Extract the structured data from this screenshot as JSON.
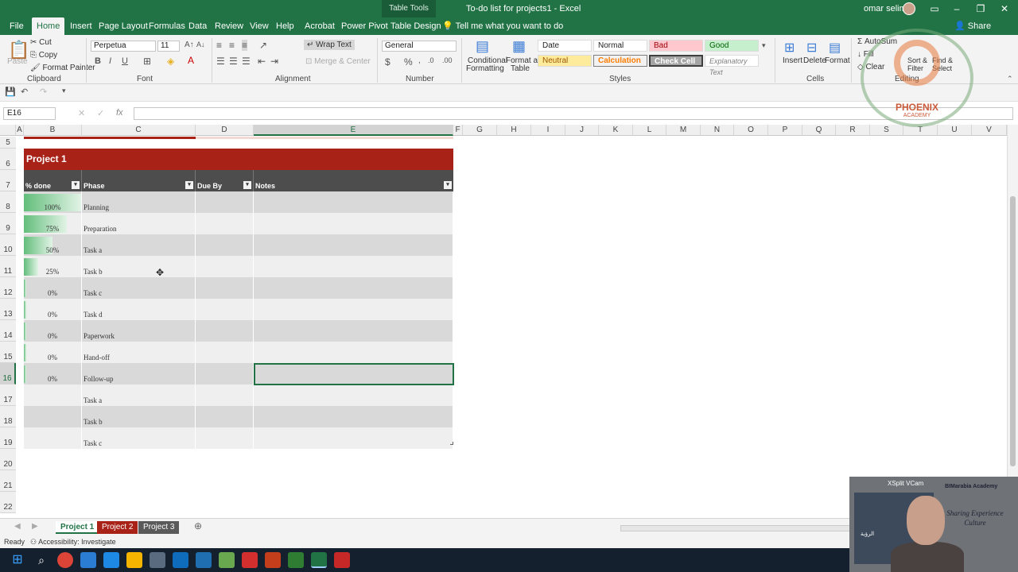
{
  "window": {
    "table_tools": "Table Tools",
    "title": "To-do list for projects1 - Excel",
    "user": "omar selim"
  },
  "ribbon_tabs": [
    "File",
    "Home",
    "Insert",
    "Page Layout",
    "Formulas",
    "Data",
    "Review",
    "View",
    "Help",
    "Acrobat",
    "Power Pivot",
    "Table Design"
  ],
  "tell_me": "Tell me what you want to do",
  "share": "Share",
  "clipboard": {
    "cut": "Cut",
    "copy": "Copy",
    "format_painter": "Format Painter",
    "paste": "Paste",
    "label": "Clipboard"
  },
  "font": {
    "name": "Perpetua",
    "size": "11",
    "label": "Font"
  },
  "alignment": {
    "wrap": "Wrap Text",
    "merge": "Merge & Center",
    "label": "Alignment"
  },
  "number": {
    "format": "General",
    "label": "Number"
  },
  "styles": {
    "conditional": "Conditional",
    "formatting": "Formatting",
    "format_as": "Format as",
    "table": "Table",
    "cells": [
      "Date",
      "Normal",
      "Bad",
      "Good",
      "Neutral",
      "Calculation",
      "Check Cell",
      "Explanatory Text"
    ],
    "label": "Styles"
  },
  "cells_group": {
    "insert": "Insert",
    "delete": "Delete",
    "format": "Format",
    "label": "Cells"
  },
  "editing": {
    "autosum": "AutoSum",
    "fill": "Fill",
    "clear": "Clear",
    "sort": "Sort &",
    "filter": "Filter",
    "find": "Find &",
    "select": "Select",
    "label": "Editing"
  },
  "formula_bar": {
    "name_box": "E16",
    "fx": "fx"
  },
  "columns": [
    "A",
    "B",
    "C",
    "D",
    "E",
    "F",
    "G",
    "H",
    "I",
    "J",
    "K",
    "L",
    "M",
    "N",
    "O",
    "P",
    "Q",
    "R",
    "S",
    "T",
    "U",
    "V"
  ],
  "rows": [
    "5",
    "6",
    "7",
    "8",
    "9",
    "10",
    "11",
    "12",
    "13",
    "14",
    "15",
    "16",
    "17",
    "18",
    "19",
    "20",
    "21",
    "22"
  ],
  "table": {
    "title": "Project 1",
    "headers": [
      "% done",
      "Phase",
      "Due By",
      "Notes"
    ],
    "rows": [
      {
        "pct": "100%",
        "fill": 1.0,
        "phase": "Planning"
      },
      {
        "pct": "75%",
        "fill": 0.75,
        "phase": "Preparation"
      },
      {
        "pct": "50%",
        "fill": 0.5,
        "phase": "Task a"
      },
      {
        "pct": "25%",
        "fill": 0.25,
        "phase": "Task b"
      },
      {
        "pct": "0%",
        "fill": 0.0,
        "phase": "Task c"
      },
      {
        "pct": "0%",
        "fill": 0.0,
        "phase": "Task d"
      },
      {
        "pct": "0%",
        "fill": 0.0,
        "phase": "Paperwork"
      },
      {
        "pct": "0%",
        "fill": 0.0,
        "phase": "Hand-off"
      },
      {
        "pct": "0%",
        "fill": 0.0,
        "phase": "Follow-up"
      },
      {
        "pct": "",
        "fill": 0.0,
        "phase": "Task a"
      },
      {
        "pct": "",
        "fill": 0.0,
        "phase": "Task b"
      },
      {
        "pct": "",
        "fill": 0.0,
        "phase": "Task c"
      }
    ]
  },
  "sheet_tabs": [
    "Project 1",
    "Project 2",
    "Project 3"
  ],
  "status": {
    "ready": "Ready",
    "accessibility": "Accessibility: Investigate"
  },
  "overlay": {
    "brand": "PHOENIX",
    "academy": "ACADEMY",
    "cam_label": "XSplit VCam",
    "cam_brand": "BIMarabia Academy",
    "cam_tagline": "Sharing Experience Culture",
    "cam_arabic": "الرؤية"
  },
  "colors": {
    "excel_green": "#217346",
    "table_title": "#a82217",
    "header": "#4d4d4d",
    "band_dark": "#d9d9d9",
    "band_light": "#efefef",
    "tab_project2": "#a82217",
    "tab_project3": "#5a5a5a"
  }
}
